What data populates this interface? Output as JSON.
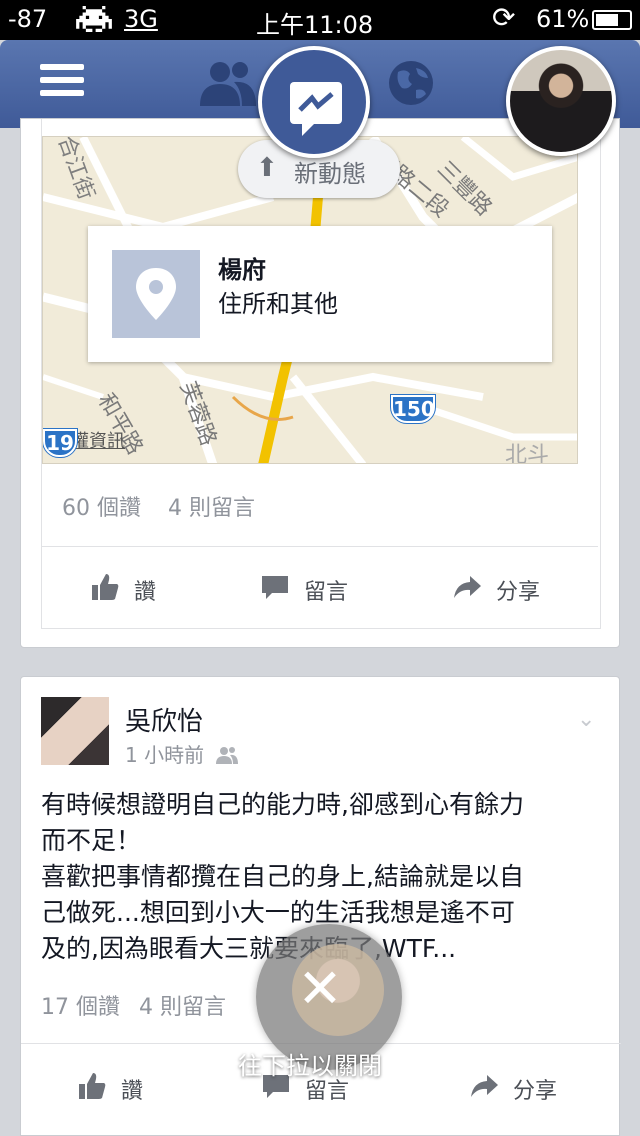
{
  "status_bar": {
    "signal": "-87",
    "network": "3G",
    "time": "上午11:08",
    "battery": "61%"
  },
  "nav": {
    "icons": [
      "menu-icon",
      "friends-icon",
      "messenger-icon",
      "globe-icon"
    ]
  },
  "map": {
    "labels": [
      "合江街",
      "正路二段",
      "三豐路",
      "和平路",
      "芙蓉路",
      "北斗",
      "新動態",
      "權資訊"
    ],
    "route_badges": [
      "150",
      "19"
    ]
  },
  "new_stories": {
    "label": "新動態"
  },
  "place": {
    "name": "楊府",
    "type": "住所和其他"
  },
  "post1": {
    "likes": "60 個讚",
    "comments": "4 則留言",
    "actions": {
      "like": "讚",
      "comment": "留言",
      "share": "分享"
    }
  },
  "post2": {
    "author": "吳欣怡",
    "time": "1 小時前",
    "lines": [
      "有時候想證明自己的能力時,卻感到心有餘力",
      "而不足！",
      "喜歡把事情都攬在自己的身上,結論就是以自",
      "己做死...想回到小大一的生活我想是遙不可",
      "及的,因為眼看大三就要來臨了,WTF..."
    ],
    "likes": "17 個讚",
    "comments": "4 則留言",
    "actions": {
      "like": "讚",
      "comment": "留言",
      "share": "分享"
    }
  },
  "overlay": {
    "hint": "往下拉以關閉"
  },
  "colors": {
    "nav_blue": "#3f5a98",
    "route_blue": "#2b73c6",
    "road_yellow": "#f2c200"
  }
}
